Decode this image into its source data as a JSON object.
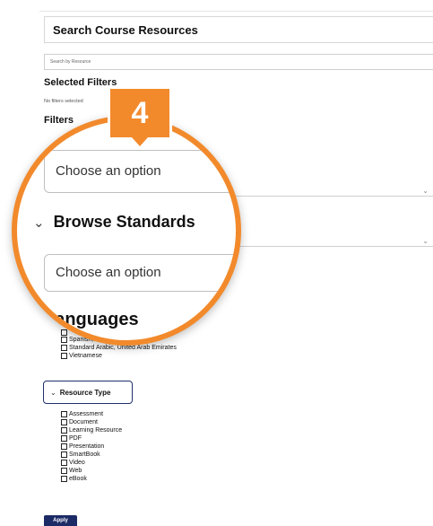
{
  "header": {
    "title": "Search Course Resources"
  },
  "search": {
    "placeholder": "Search by Resource"
  },
  "selected_filters": {
    "heading": "Selected Filters",
    "empty_text": "No filters selected"
  },
  "filters": {
    "heading": "Filters"
  },
  "magnifier": {
    "callout_number": "4",
    "select_placeholder": "Choose an option",
    "browse_standards_label": "Browse Standards",
    "languages_label": "Languages"
  },
  "languages": {
    "items": [
      "Spanish, ...",
      "Standard Arabic, United Arab Emirates",
      "Vietnamese"
    ]
  },
  "resource_type": {
    "button_label": "Resource Type",
    "items": [
      "Assessment",
      "Document",
      "Learning Resource",
      "PDF",
      "Presentation",
      "SmartBook",
      "Video",
      "Web",
      "eBook"
    ]
  },
  "apply": {
    "label": "Apply"
  },
  "icons": {
    "chevron": "chevron-down-icon",
    "caret": "caret-down-icon"
  },
  "colors": {
    "accent_orange": "#f28a2c",
    "navy": "#1c2a66"
  }
}
